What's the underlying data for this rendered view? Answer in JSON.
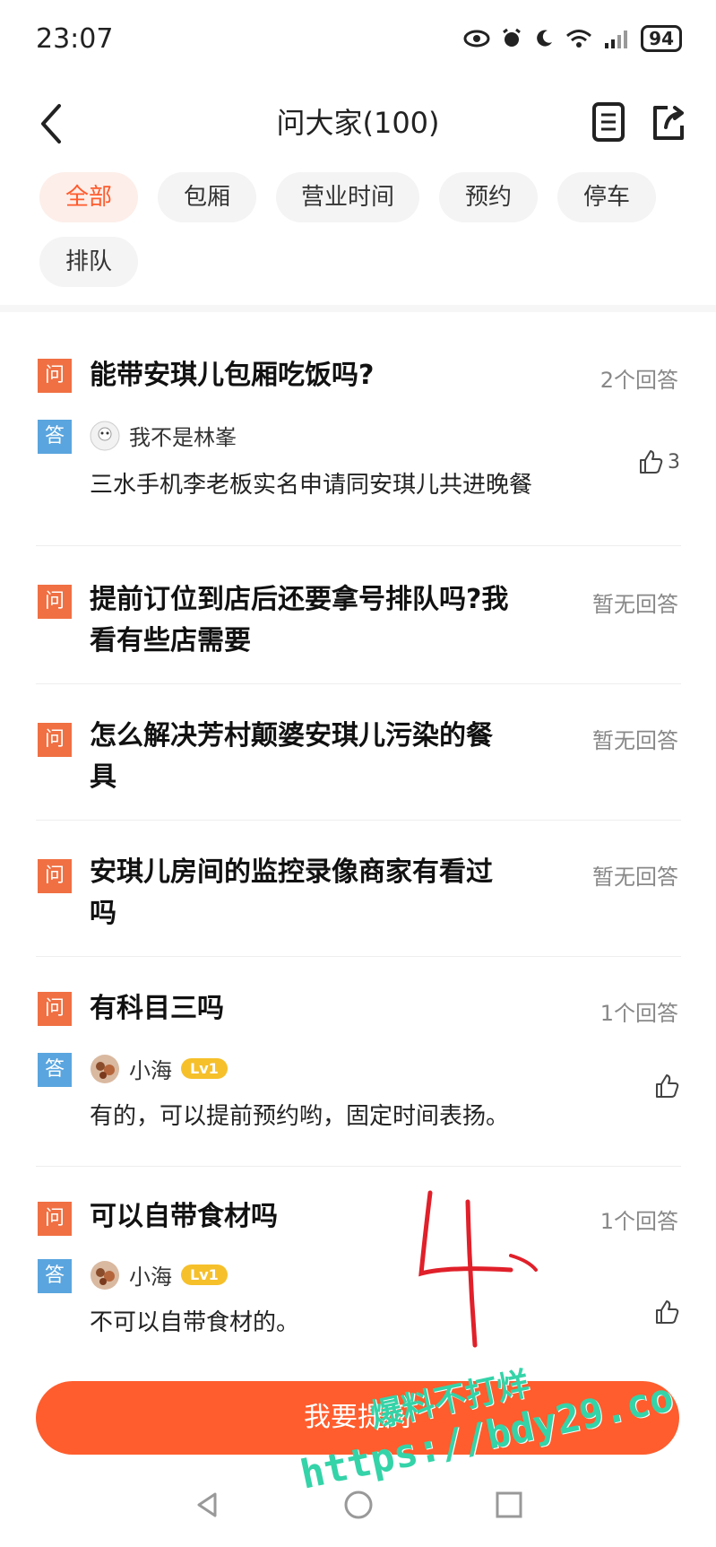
{
  "status_bar": {
    "time": "23:07",
    "battery": "94"
  },
  "header": {
    "title": "问大家(100)"
  },
  "tags": [
    "全部",
    "包厢",
    "营业时间",
    "预约",
    "停车",
    "排队"
  ],
  "badges": {
    "question": "问",
    "answer": "答"
  },
  "questions": [
    {
      "text": "能带安琪儿包厢吃饭吗?",
      "count": "2个回答",
      "answer": {
        "user": "我不是林峯",
        "text": "三水手机李老板实名申请同安琪儿共进晚餐",
        "likes": "3"
      }
    },
    {
      "text": "提前订位到店后还要拿号排队吗?我看有些店需要",
      "count": "暂无回答"
    },
    {
      "text": "怎么解决芳村颠婆安琪儿污染的餐具",
      "count": "暂无回答"
    },
    {
      "text": "安琪儿房间的监控录像商家有看过吗",
      "count": "暂无回答"
    },
    {
      "text": "有科目三吗",
      "count": "1个回答",
      "answer": {
        "user": "小海",
        "level": "Lv1",
        "text": "有的，可以提前预约哟，固定时间表扬。"
      }
    },
    {
      "text": "可以自带食材吗",
      "count": "1个回答",
      "answer": {
        "user": "小海",
        "level": "Lv1",
        "text": "不可以自带食材的。"
      }
    }
  ],
  "ask_button": "我要提问",
  "annotation": "4",
  "watermark": {
    "line1": "爆料不打烊",
    "line2": "https://bdy29.co"
  },
  "colors": {
    "accent": "#ff5a2c",
    "question_badge": "#f07043",
    "answer_badge": "#5aa5df",
    "level_badge": "#f6c02b"
  }
}
